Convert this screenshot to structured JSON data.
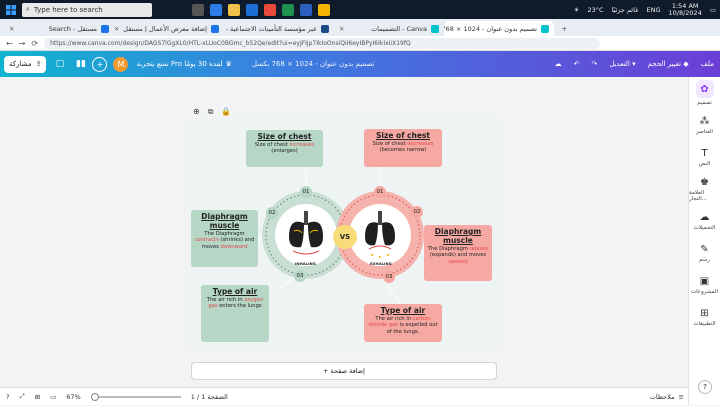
{
  "taskbar": {
    "search_placeholder": "Type here to search",
    "weather": "23°C",
    "weather_desc": "غائم جزئيًا",
    "lang": "ENG",
    "time": "1:54 AM",
    "date": "10/8/2024"
  },
  "browser": {
    "tabs": [
      {
        "label": "مستقل - Search",
        "active": false
      },
      {
        "label": "إضافة معرض الأعمال | مستقل",
        "active": false
      },
      {
        "label": "عبر مؤسسة التأمينات الاجتماعية -",
        "active": false
      },
      {
        "label": "Canva - التصميمات",
        "active": false
      },
      {
        "label": "تصميم بدون عنوان - 1024 × 768",
        "active": true
      }
    ],
    "url": "https://www.canva.com/design/DAGS7lGgXL0/HTL-xLUoC0BGmc_b52Qe/edit?ui=eyJFIjp7IkIoOnsiQiI6eyIBPyI6IkIxIiX19fQ"
  },
  "toolbar": {
    "share_label": "مشاركة",
    "avatar_letter": "M",
    "pro_label": "تمتع بتجربة Pro لمدة 30 يومًا",
    "doc_title": "تصميم بدون عنوان - 1024 × 768 بكسل",
    "edit_label": "التعديل",
    "resize_label": "تغيير الحجم",
    "file_label": "ملف"
  },
  "rail": [
    {
      "label": "تصميم",
      "icon": "design-icon"
    },
    {
      "label": "العناصر",
      "icon": "elements-icon"
    },
    {
      "label": "النص",
      "icon": "text-icon"
    },
    {
      "label": "العلامة التجار...",
      "icon": "brand-icon"
    },
    {
      "label": "التحميلات",
      "icon": "uploads-icon"
    },
    {
      "label": "رسم",
      "icon": "draw-icon"
    },
    {
      "label": "المشروعات",
      "icon": "projects-icon"
    },
    {
      "label": "التطبيقات",
      "icon": "apps-icon"
    }
  ],
  "design": {
    "vs": "VS",
    "inhaling": "INHALING",
    "exhaling": "EXHALING",
    "left": {
      "chest_title": "Size of chest",
      "chest_pre": "Size of chest ",
      "chest_kw": "increases",
      "chest_post": " (enlarges)",
      "dia_title": "Diaphragm muscle",
      "dia_pre": "The Diaphragm ",
      "dia_kw": "contracts",
      "dia_mid": " (shrinks) and moves ",
      "dia_kw2": "downward",
      "air_title": "Type of air",
      "air_pre": "The air rich in ",
      "air_kw": "oxygen gas",
      "air_post": " enters the lungs"
    },
    "right": {
      "chest_title": "Size of chest",
      "chest_pre": "Size of chest ",
      "chest_kw": "decreases",
      "chest_post": " (becomes narrow)",
      "dia_title": "Diaphragm muscle",
      "dia_pre": "The Diaphragm ",
      "dia_kw": "relaxes",
      "dia_mid": " (expands) and moves ",
      "dia_kw2": "upward",
      "air_title": "Type of air",
      "air_pre": "The air rich in ",
      "air_kw": "carbon dioxide gas",
      "air_post": " is expelled out of the lungs."
    },
    "numbers": [
      "01",
      "02",
      "03"
    ]
  },
  "add_page_label": "+ إضافة صفحة",
  "status": {
    "zoom": "67%",
    "page": "الصفحة 1 / 1",
    "notes": "ملاحظات",
    "help": "?"
  },
  "colors": {
    "green": "#b6d6c6",
    "pink": "#f6a9a3",
    "keyword_red": "#e34b4b",
    "vs": "#f8dc7a"
  }
}
